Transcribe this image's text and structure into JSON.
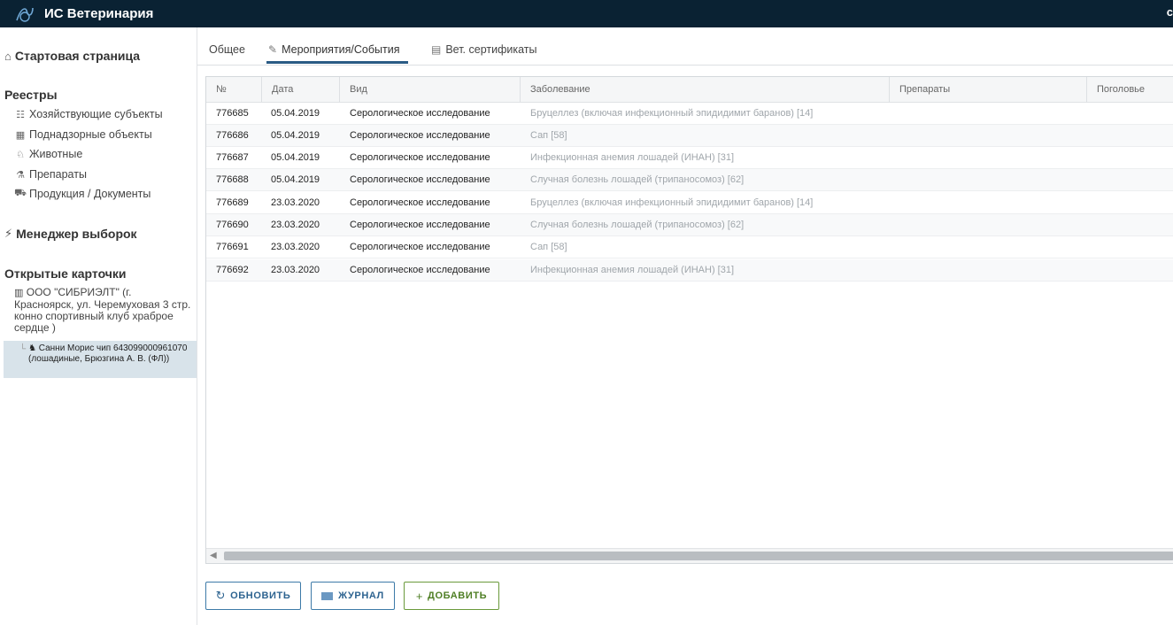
{
  "app": {
    "title": "ИС Ветеринария",
    "top_right_text": "c"
  },
  "sidebar": {
    "home_label": "Стартовая страница",
    "registries_heading": "Реестры",
    "registries": [
      {
        "label": "Хозяйствующие субъекты",
        "icon": "people-icon"
      },
      {
        "label": "Поднадзорные объекты",
        "icon": "building-icon"
      },
      {
        "label": "Животные",
        "icon": "animal-icon"
      },
      {
        "label": "Препараты",
        "icon": "flask-icon"
      },
      {
        "label": "Продукция / Документы",
        "icon": "truck-icon"
      }
    ],
    "selection_manager_label": "Менеджер выборок",
    "open_cards_heading": "Открытые карточки",
    "open_cards": [
      {
        "label": "ООО \"СИБРИЭЛТ\" (г. Красноярск, ул. Черемуховая 3 стр. конно спортивный клуб храброе сердце )"
      },
      {
        "label": "Санни Морис чип 643099000961070 (лошадиные, Брюзгина А. В. (ФЛ))"
      }
    ]
  },
  "tabs": [
    {
      "label": "Общее",
      "active": false
    },
    {
      "label": "Мероприятия/События",
      "active": true
    },
    {
      "label": "Вет. сертификаты",
      "active": false
    }
  ],
  "table": {
    "columns": [
      "№",
      "Дата",
      "Вид",
      "Заболевание",
      "Препараты",
      "Поголовье"
    ],
    "rows": [
      {
        "num": "776685",
        "date": "05.04.2019",
        "type": "Серологическое исследование",
        "disease": "Бруцеллез (включая инфекционный эпидидимит баранов) [14]"
      },
      {
        "num": "776686",
        "date": "05.04.2019",
        "type": "Серологическое исследование",
        "disease": "Сап [58]"
      },
      {
        "num": "776687",
        "date": "05.04.2019",
        "type": "Серологическое исследование",
        "disease": "Инфекционная анемия лошадей (ИНАН) [31]"
      },
      {
        "num": "776688",
        "date": "05.04.2019",
        "type": "Серологическое исследование",
        "disease": "Случная болезнь лошадей (трипаносомоз) [62]"
      },
      {
        "num": "776689",
        "date": "23.03.2020",
        "type": "Серологическое исследование",
        "disease": "Бруцеллез (включая инфекционный эпидидимит баранов) [14]"
      },
      {
        "num": "776690",
        "date": "23.03.2020",
        "type": "Серологическое исследование",
        "disease": "Случная болезнь лошадей (трипаносомоз) [62]"
      },
      {
        "num": "776691",
        "date": "23.03.2020",
        "type": "Серологическое исследование",
        "disease": "Сап [58]"
      },
      {
        "num": "776692",
        "date": "23.03.2020",
        "type": "Серологическое исследование",
        "disease": "Инфекционная анемия лошадей (ИНАН) [31]"
      }
    ]
  },
  "buttons": {
    "refresh": "Обновить",
    "journal": "Журнал",
    "add": "Добавить"
  },
  "colors": {
    "topbar": "#0a2233",
    "accent_blue": "#2d6390",
    "accent_green": "#4f7f25",
    "selected_card": "#d8e3ea"
  }
}
